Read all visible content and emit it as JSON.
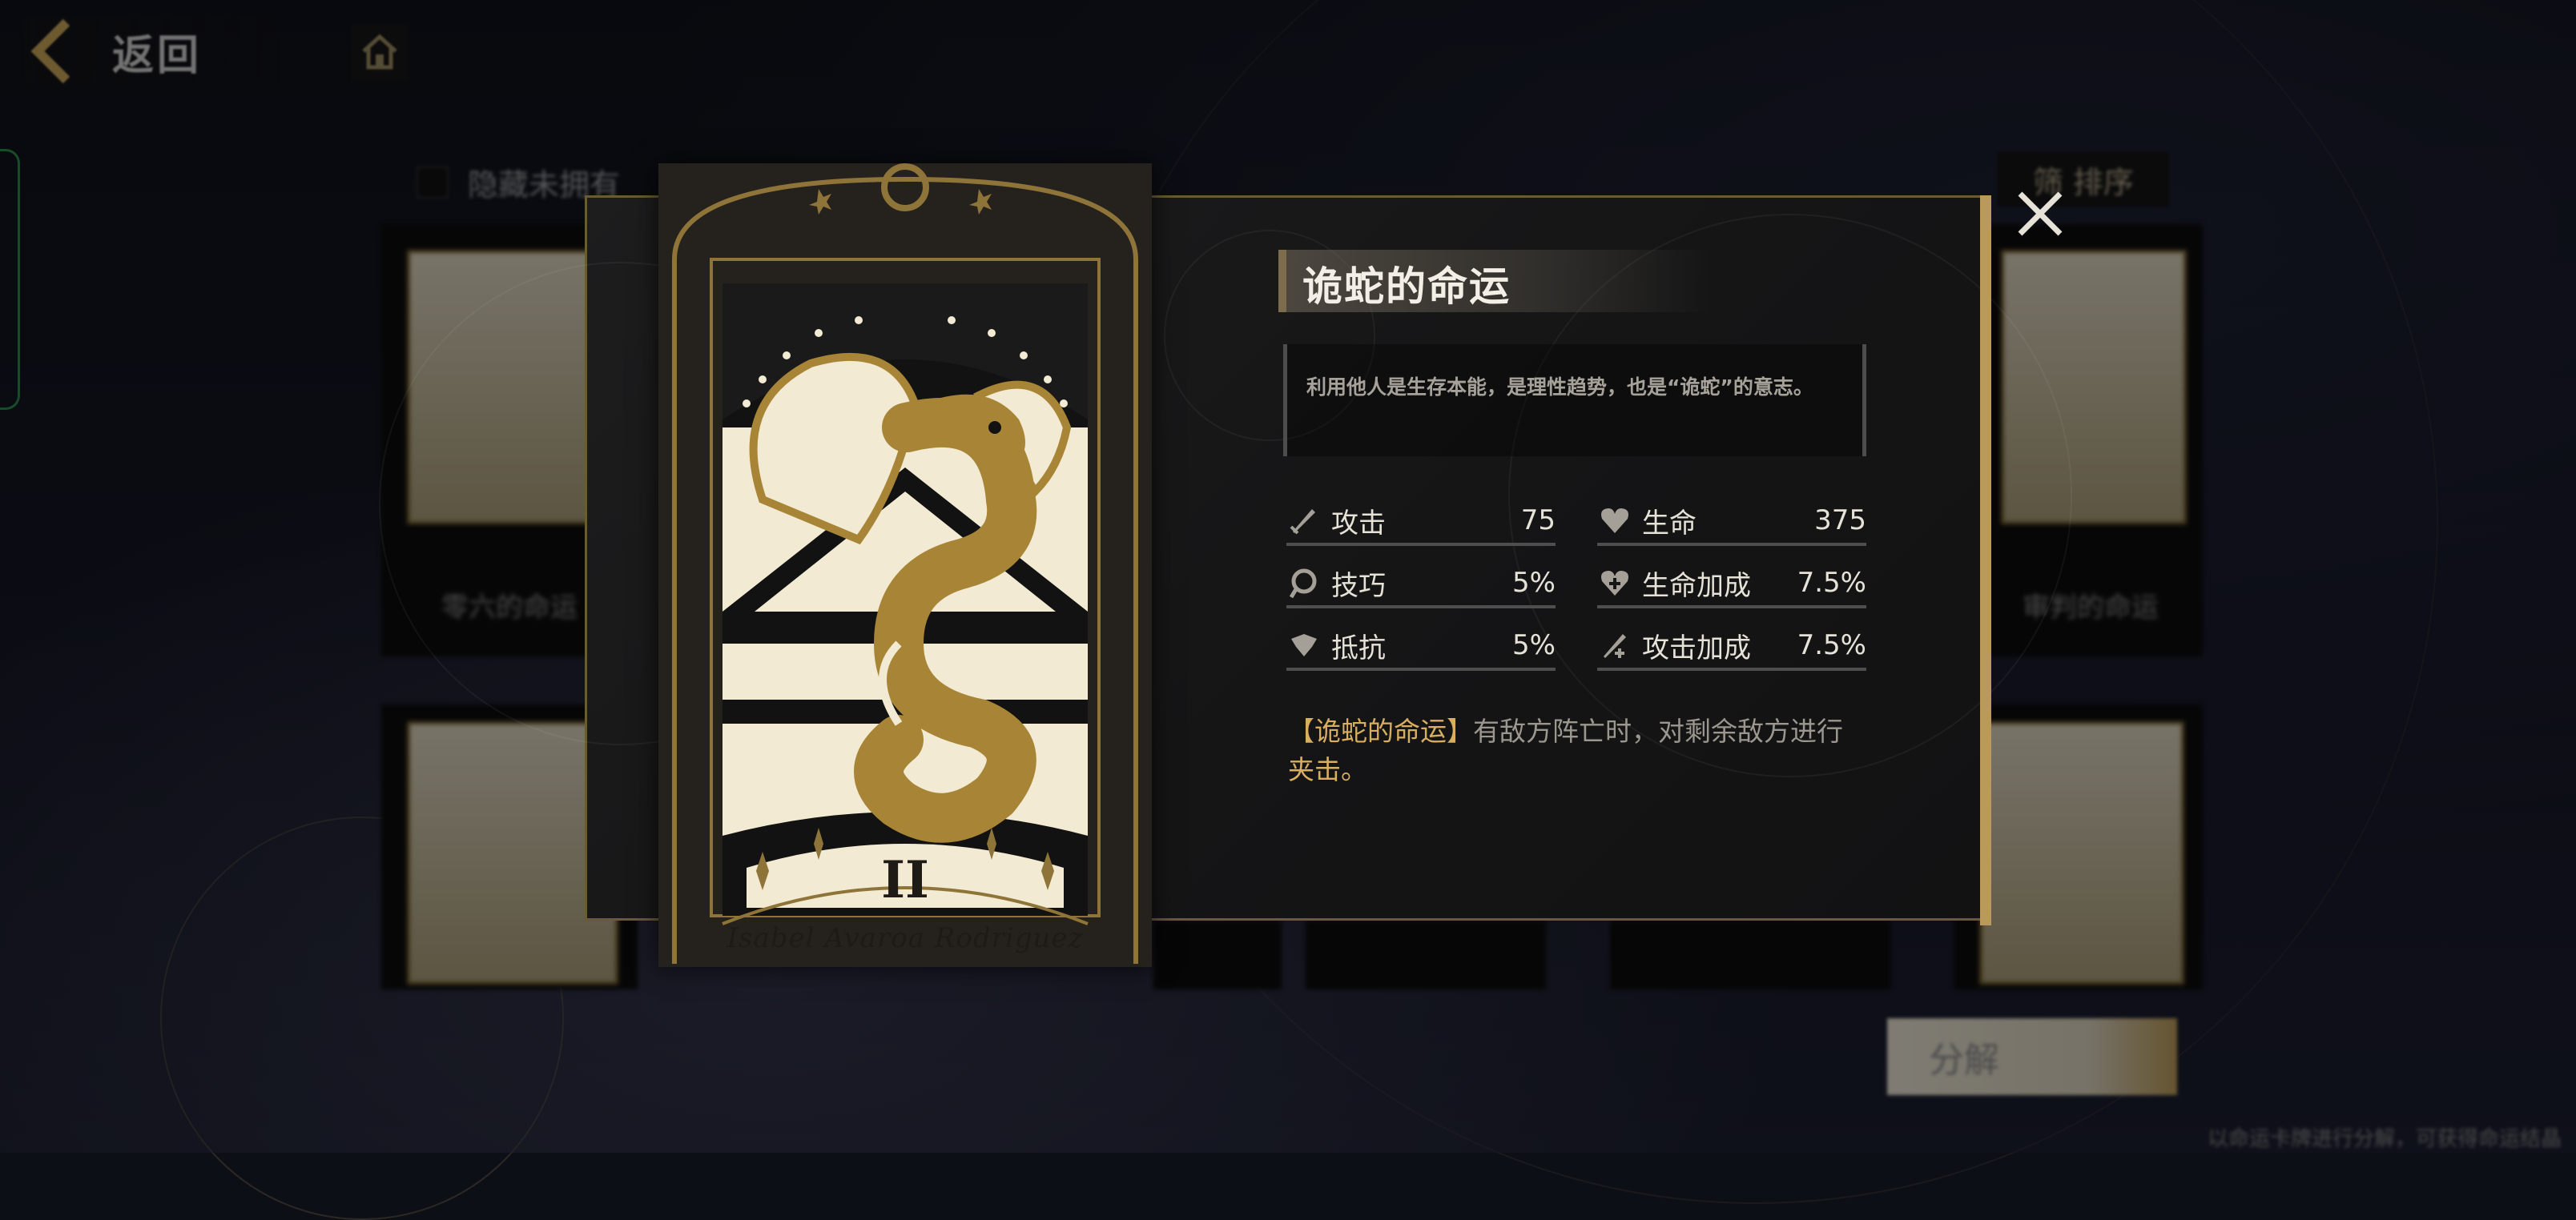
{
  "topbar": {
    "back_label": "返回",
    "icons": {
      "back": "chevron-left-icon",
      "home": "home-icon"
    }
  },
  "background": {
    "hide_unowned_label": "隐藏未拥有",
    "sort_label": "筛 排序",
    "cards": [
      {
        "name": "零六的命运"
      },
      {
        "name": "审判的命运"
      }
    ],
    "decompose_label": "分解",
    "hint_text": "以命运卡牌进行分解，可获得命运结晶"
  },
  "modal": {
    "card": {
      "numeral": "II",
      "name": "Isabel Avaroa Rodriguez"
    },
    "title": "诡蛇的命运",
    "description": "利用他人是生存本能，是理性趋势，也是“诡蛇”的意志。",
    "stats": [
      {
        "label": "攻击",
        "value": "75",
        "icon": "sword-icon"
      },
      {
        "label": "生命",
        "value": "375",
        "icon": "heart-icon"
      },
      {
        "label": "技巧",
        "value": "5%",
        "icon": "skill-icon"
      },
      {
        "label": "生命加成",
        "value": "7.5%",
        "icon": "heart-plus-icon"
      },
      {
        "label": "抵抗",
        "value": "5%",
        "icon": "shield-icon"
      },
      {
        "label": "攻击加成",
        "value": "7.5%",
        "icon": "sword-plus-icon"
      }
    ],
    "effect": {
      "name": "【诡蛇的命运】",
      "text_part1": "有敌方阵亡时，对剩余敌方进行",
      "text_part2": "夹击。"
    },
    "close_icon": "close-icon"
  },
  "colors": {
    "accent_gold": "#b99a5a",
    "highlight": "#d8ae60",
    "card_cream": "#f2ead2",
    "snake_gold": "#a88536"
  }
}
